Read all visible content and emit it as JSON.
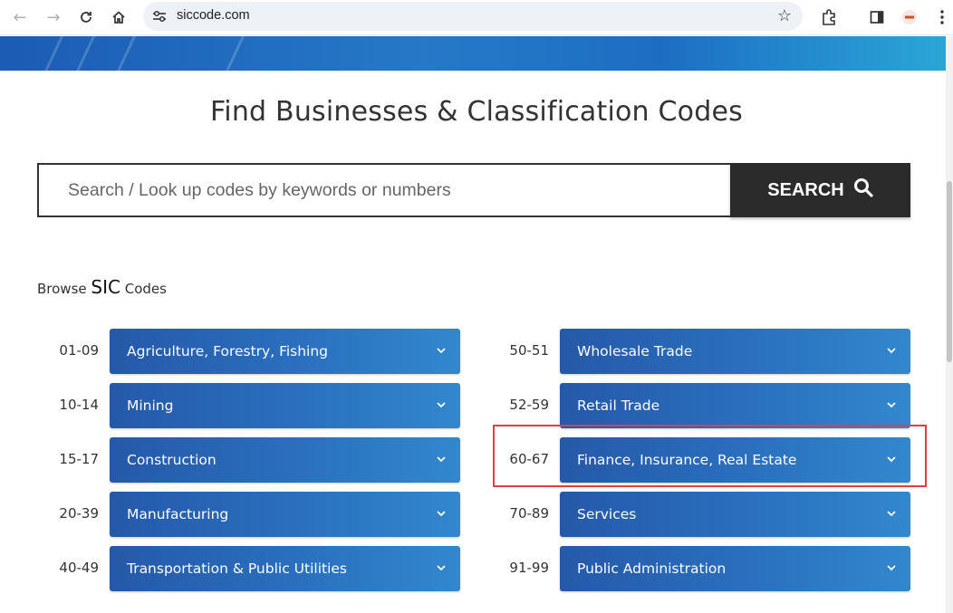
{
  "browser": {
    "url": "siccode.com"
  },
  "page": {
    "title": "Find Businesses & Classification Codes",
    "search": {
      "placeholder": "Search / Look up codes by keywords or numbers",
      "button_label": "SEARCH"
    },
    "browse": {
      "prefix": "Browse",
      "emphasis": "SIC",
      "suffix": "Codes"
    },
    "left_categories": [
      {
        "code": "01-09",
        "label": "Agriculture, Forestry, Fishing"
      },
      {
        "code": "10-14",
        "label": "Mining"
      },
      {
        "code": "15-17",
        "label": "Construction"
      },
      {
        "code": "20-39",
        "label": "Manufacturing"
      },
      {
        "code": "40-49",
        "label": "Transportation & Public Utilities"
      }
    ],
    "right_categories": [
      {
        "code": "50-51",
        "label": "Wholesale Trade"
      },
      {
        "code": "52-59",
        "label": "Retail Trade"
      },
      {
        "code": "60-67",
        "label": "Finance, Insurance, Real Estate"
      },
      {
        "code": "70-89",
        "label": "Services"
      },
      {
        "code": "91-99",
        "label": "Public Administration"
      }
    ]
  },
  "colors": {
    "category_bg": "#2a70bf",
    "search_button_bg": "#2b2b2b",
    "highlight_border": "#e0403e"
  }
}
